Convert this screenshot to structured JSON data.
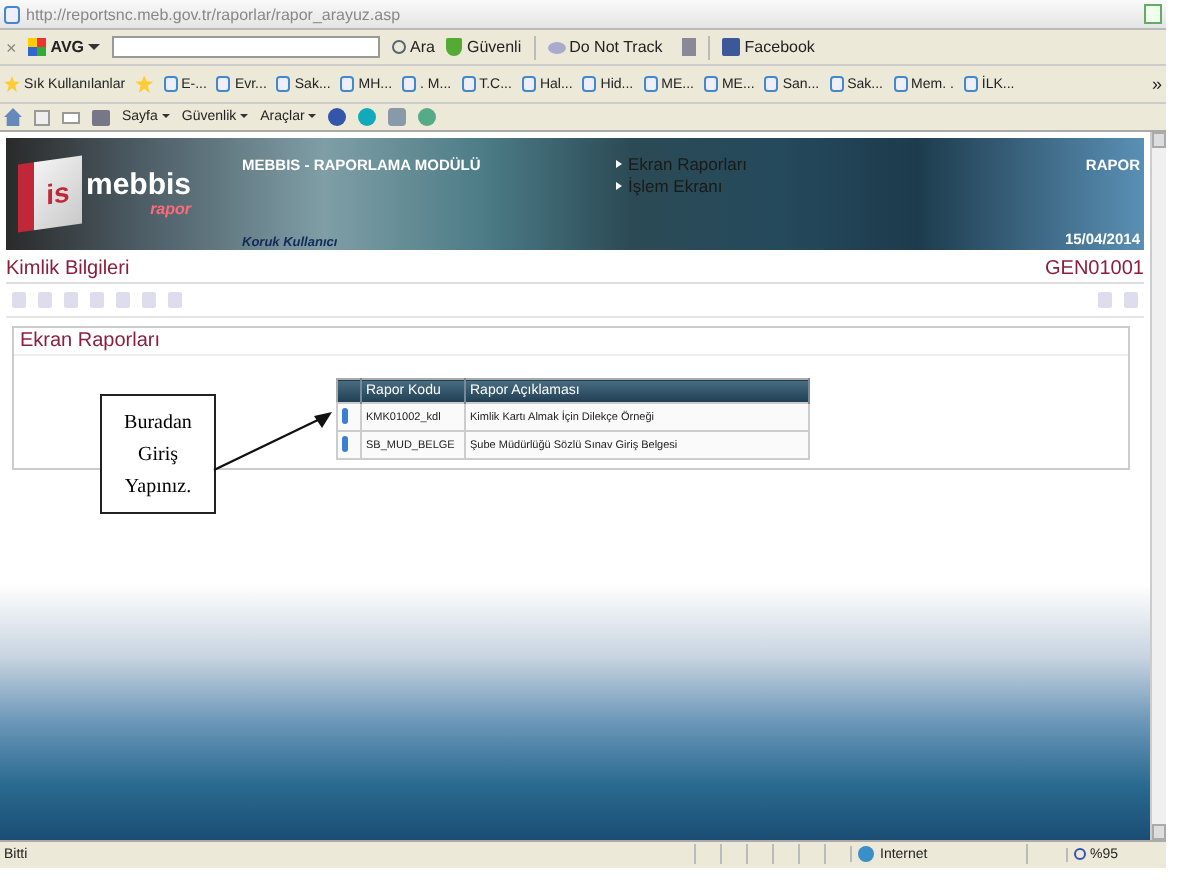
{
  "address_bar": {
    "url": "http://reportsnc.meb.gov.tr/raporlar/rapor_arayuz.asp"
  },
  "toolbar": {
    "close": "×",
    "avg": "AVG",
    "search_button": "Ara",
    "safe": "Güvenli",
    "dnt": "Do Not Track",
    "facebook": "Facebook"
  },
  "favorites_bar": {
    "title": "Sık Kullanılanlar",
    "items": [
      "E-...",
      "Evr...",
      "Sak...",
      "MH...",
      ". M...",
      "T.C...",
      "Hal...",
      "Hid...",
      "ME...",
      "ME...",
      "San...",
      "Sak...",
      "Mem. .",
      "İLK..."
    ],
    "more": "»"
  },
  "command_bar": {
    "menus": [
      "Sayfa",
      "Güvenlik",
      "Araçlar"
    ]
  },
  "banner": {
    "logo": "mebbis",
    "logo_sub": "rapor",
    "cube": "is",
    "module": "MEBBIS - RAPORLAMA MODÜLÜ",
    "user": "Koruk Kullanıcı",
    "nav": [
      "Ekran Raporları",
      "İşlem Ekranı"
    ],
    "section": "RAPOR",
    "date": "15/04/2014"
  },
  "title_row": {
    "title": "Kimlik Bilgileri",
    "code": "GEN01001"
  },
  "panel": {
    "title": "Ekran Raporları",
    "table": {
      "columns": [
        "Rapor Kodu",
        "Rapor Açıklaması"
      ],
      "rows": [
        [
          "KMK01002_kdl",
          "Kimlik Kartı Almak İçin Dilekçe Örneği"
        ],
        [
          "SB_MUD_BELGE",
          "Şube Müdürlüğü Sözlü Sınav Giriş Belgesi"
        ]
      ]
    }
  },
  "callout": {
    "text": "Buradan Giriş Yapınız."
  },
  "status_bar": {
    "status": "Bitti",
    "zone": "Internet",
    "zoom": "%95"
  }
}
